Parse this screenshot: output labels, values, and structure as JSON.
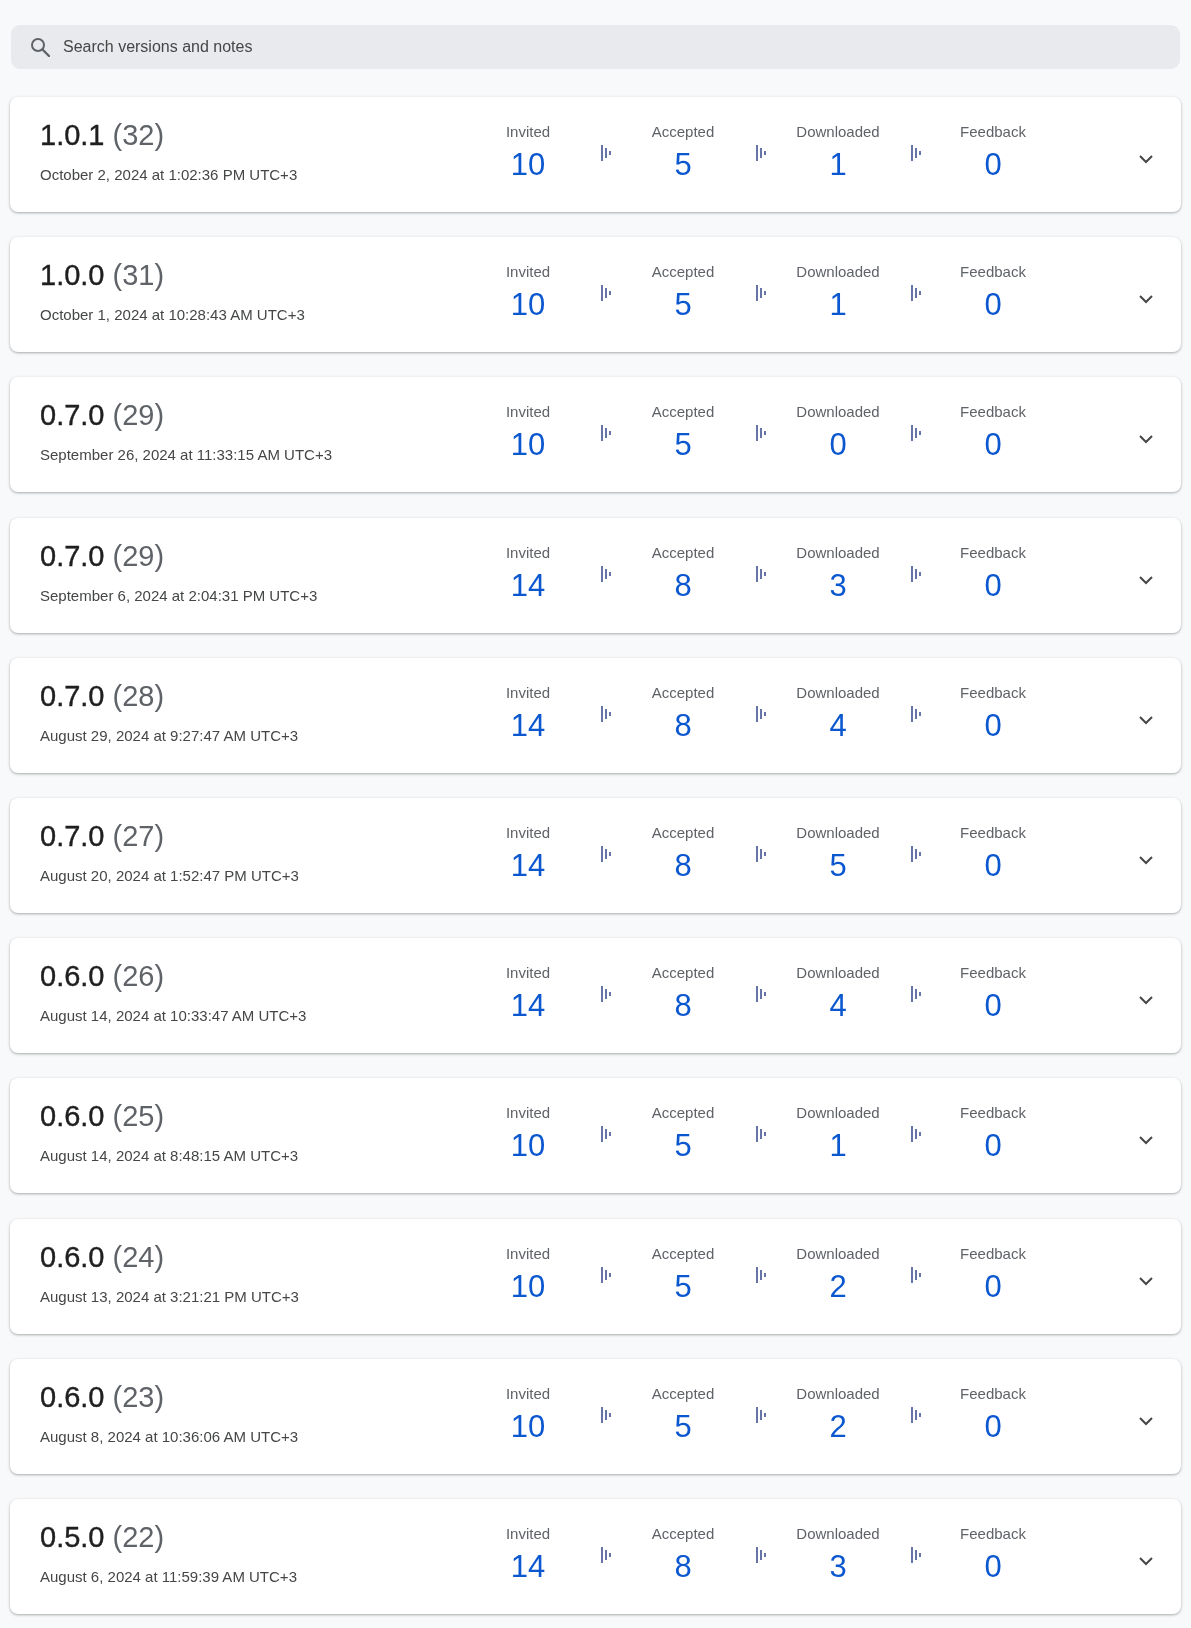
{
  "search": {
    "placeholder": "Search versions and notes"
  },
  "releases": [
    {
      "version": "1.0.1",
      "build": "(32)",
      "date": "October 2, 2024 at 1:02:36 PM UTC+3",
      "expanded": false,
      "stats": [
        {
          "label": "Invited",
          "value": "10"
        },
        {
          "label": "Accepted",
          "value": "5"
        },
        {
          "label": "Downloaded",
          "value": "1"
        },
        {
          "label": "Feedback",
          "value": "0"
        }
      ]
    },
    {
      "version": "1.0.0",
      "build": "(31)",
      "date": "October 1, 2024 at 10:28:43 AM UTC+3",
      "expanded": false,
      "stats": [
        {
          "label": "Invited",
          "value": "10"
        },
        {
          "label": "Accepted",
          "value": "5"
        },
        {
          "label": "Downloaded",
          "value": "1"
        },
        {
          "label": "Feedback",
          "value": "0"
        }
      ]
    },
    {
      "version": "0.7.0",
      "build": "(29)",
      "date": "September 26, 2024 at 11:33:15 AM UTC+3",
      "expanded": false,
      "stats": [
        {
          "label": "Invited",
          "value": "10"
        },
        {
          "label": "Accepted",
          "value": "5"
        },
        {
          "label": "Downloaded",
          "value": "0"
        },
        {
          "label": "Feedback",
          "value": "0"
        }
      ]
    },
    {
      "version": "0.7.0",
      "build": "(29)",
      "date": "September 6, 2024 at 2:04:31 PM UTC+3",
      "expanded": false,
      "stats": [
        {
          "label": "Invited",
          "value": "14"
        },
        {
          "label": "Accepted",
          "value": "8"
        },
        {
          "label": "Downloaded",
          "value": "3"
        },
        {
          "label": "Feedback",
          "value": "0"
        }
      ]
    },
    {
      "version": "0.7.0",
      "build": "(28)",
      "date": "August 29, 2024 at 9:27:47 AM UTC+3",
      "expanded": false,
      "stats": [
        {
          "label": "Invited",
          "value": "14"
        },
        {
          "label": "Accepted",
          "value": "8"
        },
        {
          "label": "Downloaded",
          "value": "4"
        },
        {
          "label": "Feedback",
          "value": "0"
        }
      ]
    },
    {
      "version": "0.7.0",
      "build": "(27)",
      "date": "August 20, 2024 at 1:52:47 PM UTC+3",
      "expanded": false,
      "stats": [
        {
          "label": "Invited",
          "value": "14"
        },
        {
          "label": "Accepted",
          "value": "8"
        },
        {
          "label": "Downloaded",
          "value": "5"
        },
        {
          "label": "Feedback",
          "value": "0"
        }
      ]
    },
    {
      "version": "0.6.0",
      "build": "(26)",
      "date": "August 14, 2024 at 10:33:47 AM UTC+3",
      "expanded": false,
      "stats": [
        {
          "label": "Invited",
          "value": "14"
        },
        {
          "label": "Accepted",
          "value": "8"
        },
        {
          "label": "Downloaded",
          "value": "4"
        },
        {
          "label": "Feedback",
          "value": "0"
        }
      ]
    },
    {
      "version": "0.6.0",
      "build": "(25)",
      "date": "August 14, 2024 at 8:48:15 AM UTC+3",
      "expanded": false,
      "stats": [
        {
          "label": "Invited",
          "value": "10"
        },
        {
          "label": "Accepted",
          "value": "5"
        },
        {
          "label": "Downloaded",
          "value": "1"
        },
        {
          "label": "Feedback",
          "value": "0"
        }
      ]
    },
    {
      "version": "0.6.0",
      "build": "(24)",
      "date": "August 13, 2024 at 3:21:21 PM UTC+3",
      "expanded": false,
      "stats": [
        {
          "label": "Invited",
          "value": "10"
        },
        {
          "label": "Accepted",
          "value": "5"
        },
        {
          "label": "Downloaded",
          "value": "2"
        },
        {
          "label": "Feedback",
          "value": "0"
        }
      ]
    },
    {
      "version": "0.6.0",
      "build": "(23)",
      "date": "August 8, 2024 at 10:36:06 AM UTC+3",
      "expanded": false,
      "stats": [
        {
          "label": "Invited",
          "value": "10"
        },
        {
          "label": "Accepted",
          "value": "5"
        },
        {
          "label": "Downloaded",
          "value": "2"
        },
        {
          "label": "Feedback",
          "value": "0"
        }
      ]
    },
    {
      "version": "0.5.0",
      "build": "(22)",
      "date": "August 6, 2024 at 11:59:39 AM UTC+3",
      "expanded": false,
      "stats": [
        {
          "label": "Invited",
          "value": "14"
        },
        {
          "label": "Accepted",
          "value": "8"
        },
        {
          "label": "Downloaded",
          "value": "3"
        },
        {
          "label": "Feedback",
          "value": "0"
        }
      ]
    }
  ]
}
